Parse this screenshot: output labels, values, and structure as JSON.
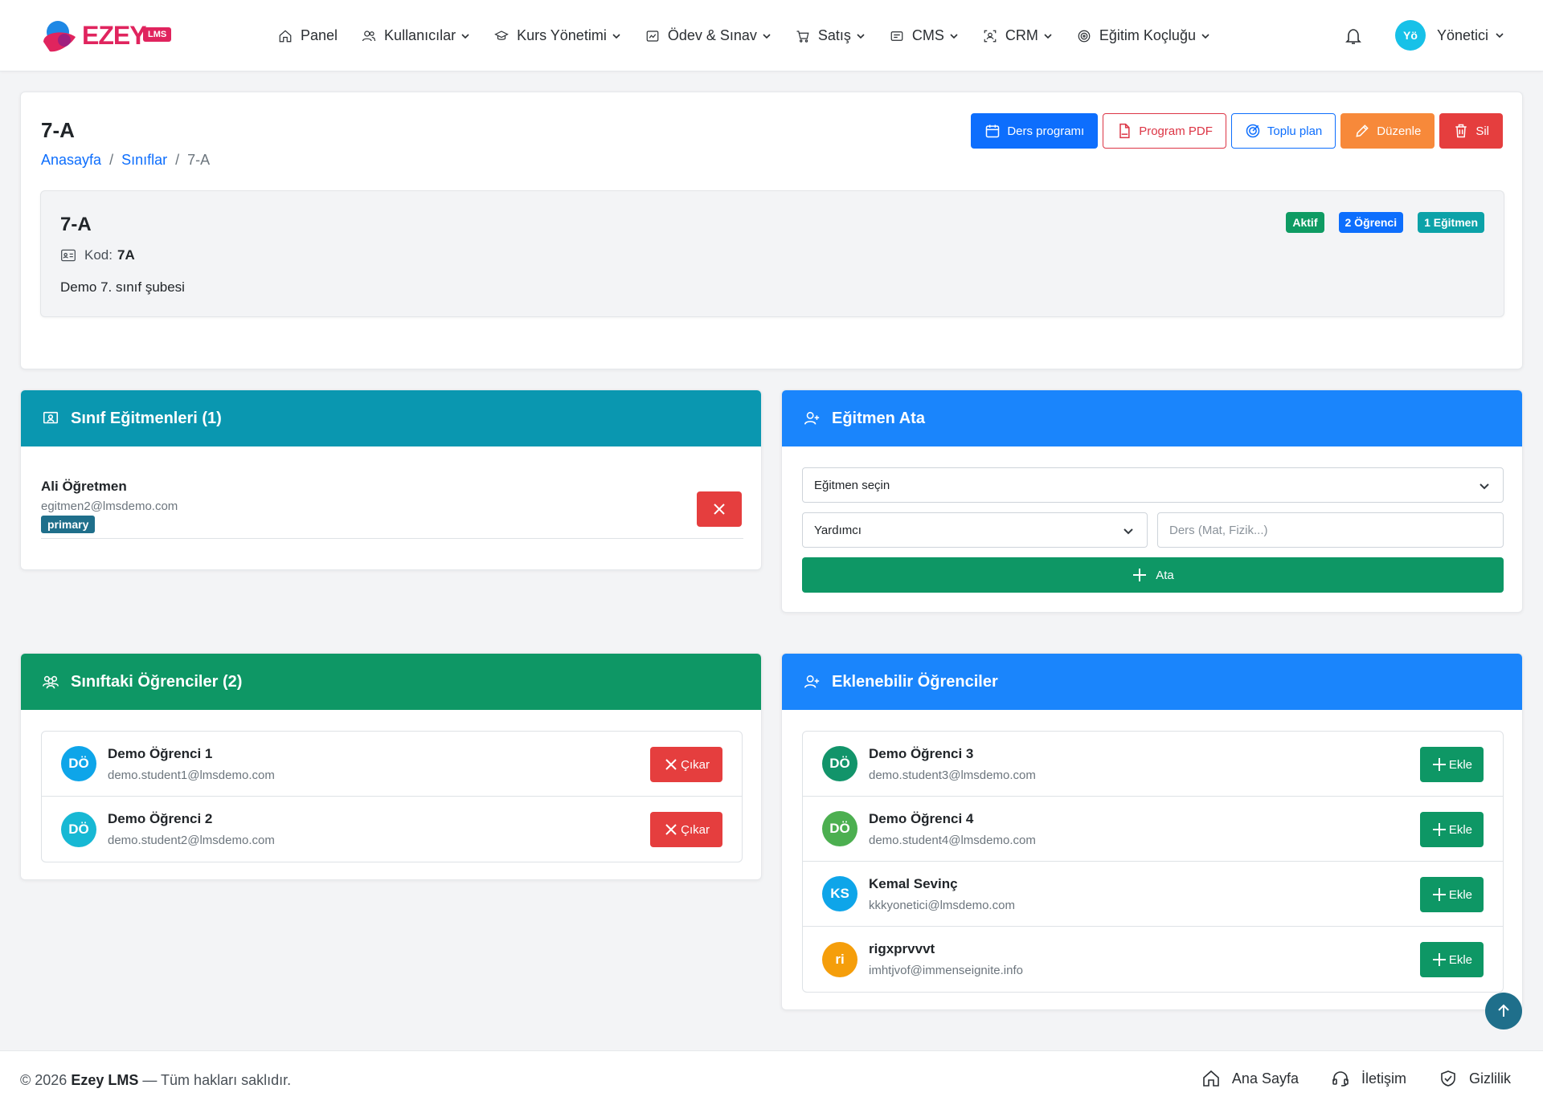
{
  "brand": {
    "name": "EZEY",
    "badge": "LMS"
  },
  "nav": {
    "items": [
      {
        "label": "Panel",
        "icon": "home-icon"
      },
      {
        "label": "Kullanıcılar",
        "icon": "users-icon"
      },
      {
        "label": "Kurs Yönetimi",
        "icon": "graduation-cap-icon"
      },
      {
        "label": "Ödev & Sınav",
        "icon": "assignment-icon"
      },
      {
        "label": "Satış",
        "icon": "cart-icon"
      },
      {
        "label": "CMS",
        "icon": "cms-icon"
      },
      {
        "label": "CRM",
        "icon": "crm-icon"
      },
      {
        "label": "Eğitim Koçluğu",
        "icon": "target-icon"
      }
    ]
  },
  "user": {
    "initials": "Yö",
    "name": "Yönetici"
  },
  "page": {
    "title": "7-A",
    "breadcrumb": [
      "Anasayfa",
      "Sınıflar",
      "7-A"
    ],
    "actions": {
      "schedule": "Ders programı",
      "pdf": "Program PDF",
      "bulk": "Toplu plan",
      "edit": "Düzenle",
      "delete": "Sil"
    }
  },
  "class_info": {
    "name": "7-A",
    "code_label": "Kod:",
    "code": "7A",
    "description": "Demo 7. sınıf şubesi",
    "badges": {
      "status": "Aktif",
      "students": "2 Öğrenci",
      "teachers": "1 Eğitmen"
    }
  },
  "teachers_panel": {
    "title": "Sınıf Eğitmenleri (1)",
    "items": [
      {
        "name": "Ali Öğretmen",
        "email": "egitmen2@lmsdemo.com",
        "role": "primary"
      }
    ]
  },
  "assign_panel": {
    "title": "Eğitmen Ata",
    "teacher_select": "Eğitmen seçin",
    "role_select": "Yardımcı",
    "subject_placeholder": "Ders (Mat, Fizik...)",
    "submit": "Ata"
  },
  "students_panel": {
    "title": "Sınıftaki Öğrenciler (2)",
    "remove_label": "Çıkar",
    "items": [
      {
        "initials": "DÖ",
        "name": "Demo Öğrenci 1",
        "email": "demo.student1@lmsdemo.com",
        "color": "#0ea5e9"
      },
      {
        "initials": "DÖ",
        "name": "Demo Öğrenci 2",
        "email": "demo.student2@lmsdemo.com",
        "color": "#17b8d4"
      }
    ]
  },
  "available_panel": {
    "title": "Eklenebilir Öğrenciler",
    "add_label": "Ekle",
    "items": [
      {
        "initials": "DÖ",
        "name": "Demo Öğrenci 3",
        "email": "demo.student3@lmsdemo.com",
        "color": "#12946a"
      },
      {
        "initials": "DÖ",
        "name": "Demo Öğrenci 4",
        "email": "demo.student4@lmsdemo.com",
        "color": "#4caf50"
      },
      {
        "initials": "KS",
        "name": "Kemal Sevinç",
        "email": "kkkyonetici@lmsdemo.com",
        "color": "#0ea5e9"
      },
      {
        "initials": "ri",
        "name": "rigxprvvvt",
        "email": "imhtjvof@immenseignite.info",
        "color": "#f59e0b"
      }
    ]
  },
  "footer": {
    "year": "© 2026",
    "brand": "Ezey LMS",
    "rights": "— Tüm hakları saklıdır.",
    "links": [
      {
        "label": "Ana Sayfa",
        "icon": "home-icon"
      },
      {
        "label": "İletişim",
        "icon": "headset-icon"
      },
      {
        "label": "Gizlilik",
        "icon": "shield-icon"
      }
    ]
  },
  "colors": {
    "primary": "#0d6efd",
    "success": "#0e9765",
    "danger": "#e53e3e",
    "warning": "#f7893a",
    "info": "#0a97b0",
    "brand": "#e0245e"
  }
}
